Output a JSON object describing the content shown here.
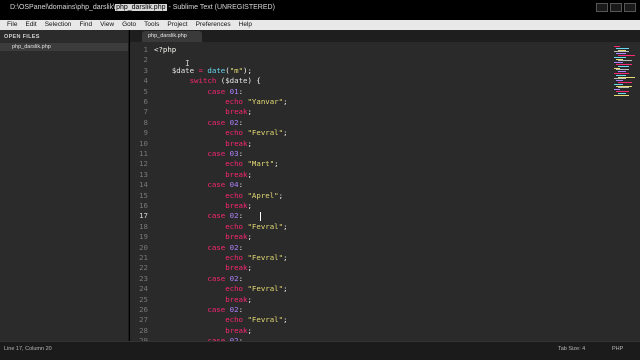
{
  "window": {
    "title_prefix": "D:\\OSPanel\\domains\\php_darslik\\",
    "title_file": "php_darslik.php",
    "title_suffix": "- Sublime Text (UNREGISTERED)"
  },
  "menu": [
    "File",
    "Edit",
    "Selection",
    "Find",
    "View",
    "Goto",
    "Tools",
    "Project",
    "Preferences",
    "Help"
  ],
  "sidebar": {
    "header": "OPEN FILES",
    "files": [
      "php_darslik.php"
    ]
  },
  "tabs": [
    {
      "label": "php_darslik.php",
      "active": true
    }
  ],
  "editor": {
    "current_line": 17,
    "lines": [
      [
        {
          "t": "<?php",
          "c": "php"
        }
      ],
      [],
      [
        {
          "t": "    ",
          "c": "p"
        },
        {
          "t": "$date",
          "c": "var"
        },
        {
          "t": " = ",
          "c": "kw"
        },
        {
          "t": "date",
          "c": "fn"
        },
        {
          "t": "(",
          "c": "p"
        },
        {
          "t": "\"m\"",
          "c": "str"
        },
        {
          "t": ");",
          "c": "p"
        }
      ],
      [
        {
          "t": "        ",
          "c": "p"
        },
        {
          "t": "switch",
          "c": "kw"
        },
        {
          "t": " (",
          "c": "p"
        },
        {
          "t": "$date",
          "c": "var"
        },
        {
          "t": ") {",
          "c": "p"
        }
      ],
      [
        {
          "t": "            ",
          "c": "p"
        },
        {
          "t": "case",
          "c": "kw"
        },
        {
          "t": " ",
          "c": "p"
        },
        {
          "t": "01",
          "c": "num"
        },
        {
          "t": ":",
          "c": "p"
        }
      ],
      [
        {
          "t": "                ",
          "c": "p"
        },
        {
          "t": "echo",
          "c": "kw"
        },
        {
          "t": " ",
          "c": "p"
        },
        {
          "t": "\"Yanvar\"",
          "c": "str"
        },
        {
          "t": ";",
          "c": "p"
        }
      ],
      [
        {
          "t": "                ",
          "c": "p"
        },
        {
          "t": "break",
          "c": "kw"
        },
        {
          "t": ";",
          "c": "p"
        }
      ],
      [
        {
          "t": "            ",
          "c": "p"
        },
        {
          "t": "case",
          "c": "kw"
        },
        {
          "t": " ",
          "c": "p"
        },
        {
          "t": "02",
          "c": "num"
        },
        {
          "t": ":",
          "c": "p"
        }
      ],
      [
        {
          "t": "                ",
          "c": "p"
        },
        {
          "t": "echo",
          "c": "kw"
        },
        {
          "t": " ",
          "c": "p"
        },
        {
          "t": "\"Fevral\"",
          "c": "str"
        },
        {
          "t": ";",
          "c": "p"
        }
      ],
      [
        {
          "t": "                ",
          "c": "p"
        },
        {
          "t": "break",
          "c": "kw"
        },
        {
          "t": ";",
          "c": "p"
        }
      ],
      [
        {
          "t": "            ",
          "c": "p"
        },
        {
          "t": "case",
          "c": "kw"
        },
        {
          "t": " ",
          "c": "p"
        },
        {
          "t": "03",
          "c": "num"
        },
        {
          "t": ":",
          "c": "p"
        }
      ],
      [
        {
          "t": "                ",
          "c": "p"
        },
        {
          "t": "echo",
          "c": "kw"
        },
        {
          "t": " ",
          "c": "p"
        },
        {
          "t": "\"Mart\"",
          "c": "str"
        },
        {
          "t": ";",
          "c": "p"
        }
      ],
      [
        {
          "t": "                ",
          "c": "p"
        },
        {
          "t": "break",
          "c": "kw"
        },
        {
          "t": ";",
          "c": "p"
        }
      ],
      [
        {
          "t": "            ",
          "c": "p"
        },
        {
          "t": "case",
          "c": "kw"
        },
        {
          "t": " ",
          "c": "p"
        },
        {
          "t": "04",
          "c": "num"
        },
        {
          "t": ":",
          "c": "p"
        }
      ],
      [
        {
          "t": "                ",
          "c": "p"
        },
        {
          "t": "echo",
          "c": "kw"
        },
        {
          "t": " ",
          "c": "p"
        },
        {
          "t": "\"Aprel\"",
          "c": "str"
        },
        {
          "t": ";",
          "c": "p"
        }
      ],
      [
        {
          "t": "                ",
          "c": "p"
        },
        {
          "t": "break",
          "c": "kw"
        },
        {
          "t": ";",
          "c": "p"
        }
      ],
      [
        {
          "t": "            ",
          "c": "p"
        },
        {
          "t": "case",
          "c": "kw"
        },
        {
          "t": " ",
          "c": "p"
        },
        {
          "t": "02",
          "c": "num"
        },
        {
          "t": ":",
          "c": "p"
        }
      ],
      [
        {
          "t": "                ",
          "c": "p"
        },
        {
          "t": "echo",
          "c": "kw"
        },
        {
          "t": " ",
          "c": "p"
        },
        {
          "t": "\"Fevral\"",
          "c": "str"
        },
        {
          "t": ";",
          "c": "p"
        }
      ],
      [
        {
          "t": "                ",
          "c": "p"
        },
        {
          "t": "break",
          "c": "kw"
        },
        {
          "t": ";",
          "c": "p"
        }
      ],
      [
        {
          "t": "            ",
          "c": "p"
        },
        {
          "t": "case",
          "c": "kw"
        },
        {
          "t": " ",
          "c": "p"
        },
        {
          "t": "02",
          "c": "num"
        },
        {
          "t": ":",
          "c": "p"
        }
      ],
      [
        {
          "t": "                ",
          "c": "p"
        },
        {
          "t": "echo",
          "c": "kw"
        },
        {
          "t": " ",
          "c": "p"
        },
        {
          "t": "\"Fevral\"",
          "c": "str"
        },
        {
          "t": ";",
          "c": "p"
        }
      ],
      [
        {
          "t": "                ",
          "c": "p"
        },
        {
          "t": "break",
          "c": "kw"
        },
        {
          "t": ";",
          "c": "p"
        }
      ],
      [
        {
          "t": "            ",
          "c": "p"
        },
        {
          "t": "case",
          "c": "kw"
        },
        {
          "t": " ",
          "c": "p"
        },
        {
          "t": "02",
          "c": "num"
        },
        {
          "t": ":",
          "c": "p"
        }
      ],
      [
        {
          "t": "                ",
          "c": "p"
        },
        {
          "t": "echo",
          "c": "kw"
        },
        {
          "t": " ",
          "c": "p"
        },
        {
          "t": "\"Fevral\"",
          "c": "str"
        },
        {
          "t": ";",
          "c": "p"
        }
      ],
      [
        {
          "t": "                ",
          "c": "p"
        },
        {
          "t": "break",
          "c": "kw"
        },
        {
          "t": ";",
          "c": "p"
        }
      ],
      [
        {
          "t": "            ",
          "c": "p"
        },
        {
          "t": "case",
          "c": "kw"
        },
        {
          "t": " ",
          "c": "p"
        },
        {
          "t": "02",
          "c": "num"
        },
        {
          "t": ":",
          "c": "p"
        }
      ],
      [
        {
          "t": "                ",
          "c": "p"
        },
        {
          "t": "echo",
          "c": "kw"
        },
        {
          "t": " ",
          "c": "p"
        },
        {
          "t": "\"Fevral\"",
          "c": "str"
        },
        {
          "t": ";",
          "c": "p"
        }
      ],
      [
        {
          "t": "                ",
          "c": "p"
        },
        {
          "t": "break",
          "c": "kw"
        },
        {
          "t": ";",
          "c": "p"
        }
      ],
      [
        {
          "t": "            ",
          "c": "p"
        },
        {
          "t": "case",
          "c": "kw"
        },
        {
          "t": " ",
          "c": "p"
        },
        {
          "t": "02",
          "c": "num"
        },
        {
          "t": ":",
          "c": "p"
        }
      ]
    ]
  },
  "status": {
    "position": "Line 17, Column 20",
    "tab_size": "Tab Size: 4",
    "syntax": "PHP"
  },
  "colors": {
    "keyword": "#f92672",
    "function": "#66d9ef",
    "string": "#e6db74",
    "number": "#ae81ff",
    "background": "#2a2a2a"
  }
}
